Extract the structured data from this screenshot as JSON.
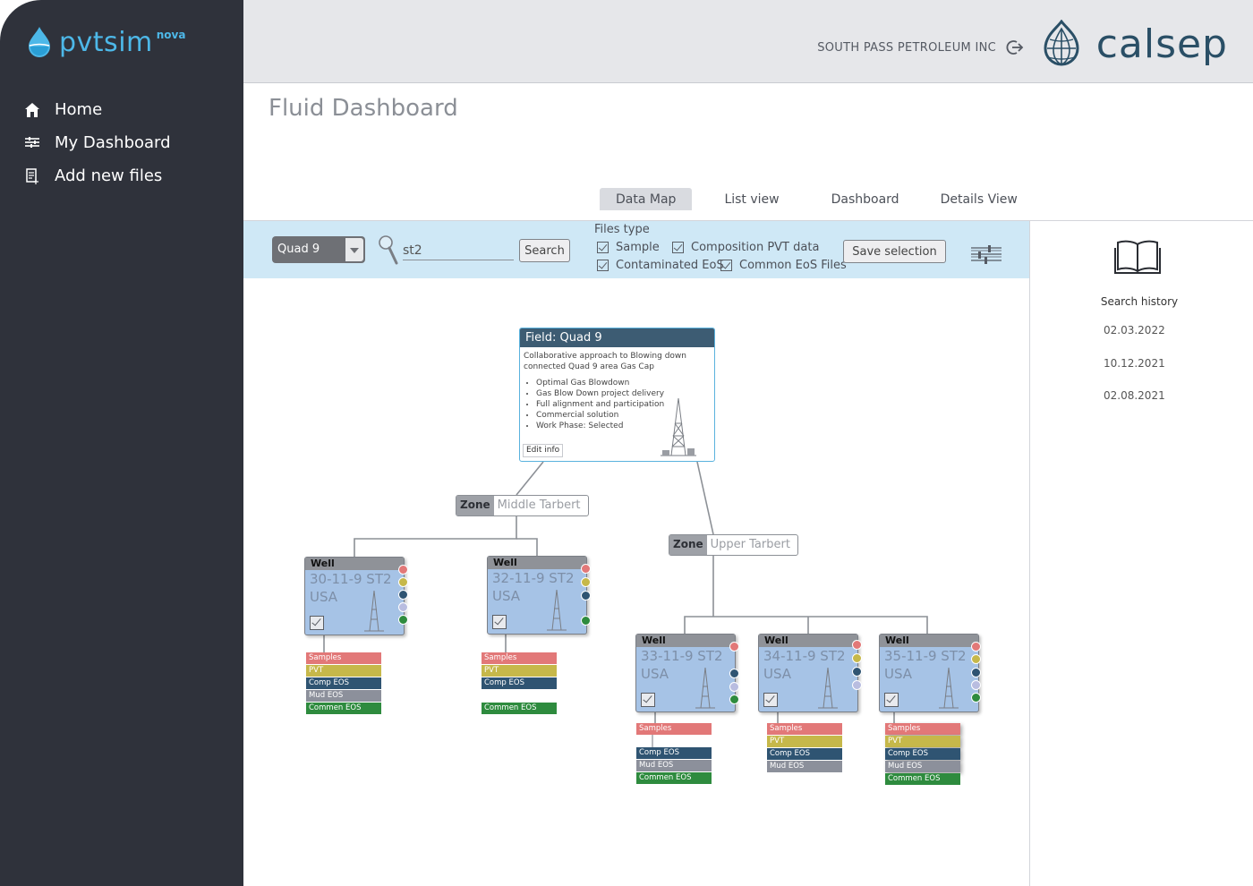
{
  "app": {
    "name": "pvtsim",
    "superscript": "nova"
  },
  "sidebar": {
    "items": [
      {
        "label": "Home",
        "icon": "home-icon"
      },
      {
        "label": "My Dashboard",
        "icon": "dashboard-icon"
      },
      {
        "label": "Add new files",
        "icon": "add-file-icon"
      }
    ]
  },
  "header": {
    "company": "SOUTH PASS PETROLEUM INC",
    "brand": "calsep"
  },
  "page": {
    "title": "Fluid Dashboard"
  },
  "tabs": [
    {
      "label": "Data Map",
      "active": true
    },
    {
      "label": "List view",
      "active": false
    },
    {
      "label": "Dashboard",
      "active": false
    },
    {
      "label": "Details View",
      "active": false
    }
  ],
  "filters": {
    "field_select": "Quad 9",
    "search_value": "st2",
    "search_button": "Search",
    "files_type_label": "Files type",
    "checkboxes": [
      {
        "label": "Sample",
        "checked": true
      },
      {
        "label": "Composition PVT data",
        "checked": true
      },
      {
        "label": "Contaminated EoS",
        "checked": true
      },
      {
        "label": "Common EoS Files",
        "checked": true
      }
    ],
    "save_button": "Save selection"
  },
  "history": {
    "title": "Search history",
    "items": [
      "02.03.2022",
      "10.12.2021",
      "02.08.2021"
    ]
  },
  "field": {
    "title": "Field: Quad 9",
    "description": "Collaborative approach to Blowing down connected Quad 9 area Gas Cap",
    "bullets": [
      "Optimal Gas Blowdown",
      "Gas Blow Down project delivery",
      "Full alignment and participation",
      "Commercial solution",
      "Work Phase: Selected"
    ],
    "edit_label": "Edit info"
  },
  "zones": [
    {
      "tag": "Zone",
      "name": "Middle Tarbert"
    },
    {
      "tag": "Zone",
      "name": "Upper Tarbert"
    }
  ],
  "wells": [
    {
      "tag": "Well",
      "name": "30-11-9 ST2",
      "country": "USA"
    },
    {
      "tag": "Well",
      "name": "32-11-9 ST2",
      "country": "USA"
    },
    {
      "tag": "Well",
      "name": "33-11-9 ST2",
      "country": "USA"
    },
    {
      "tag": "Well",
      "name": "34-11-9 ST2",
      "country": "USA"
    },
    {
      "tag": "Well",
      "name": "35-11-9 ST2",
      "country": "USA"
    }
  ],
  "file_labels": {
    "samples": "Samples",
    "pvt": "PVT",
    "comp": "Comp EOS",
    "mud": "Mud EOS",
    "commen": "Commen EOS"
  },
  "colors": {
    "samples": "#e27878",
    "pvt": "#c6b84a",
    "comp": "#2f5472",
    "mud": "#8c909b",
    "commen": "#2e8b3e",
    "sidebar": "#2f323b",
    "accent": "#4db8e8"
  }
}
